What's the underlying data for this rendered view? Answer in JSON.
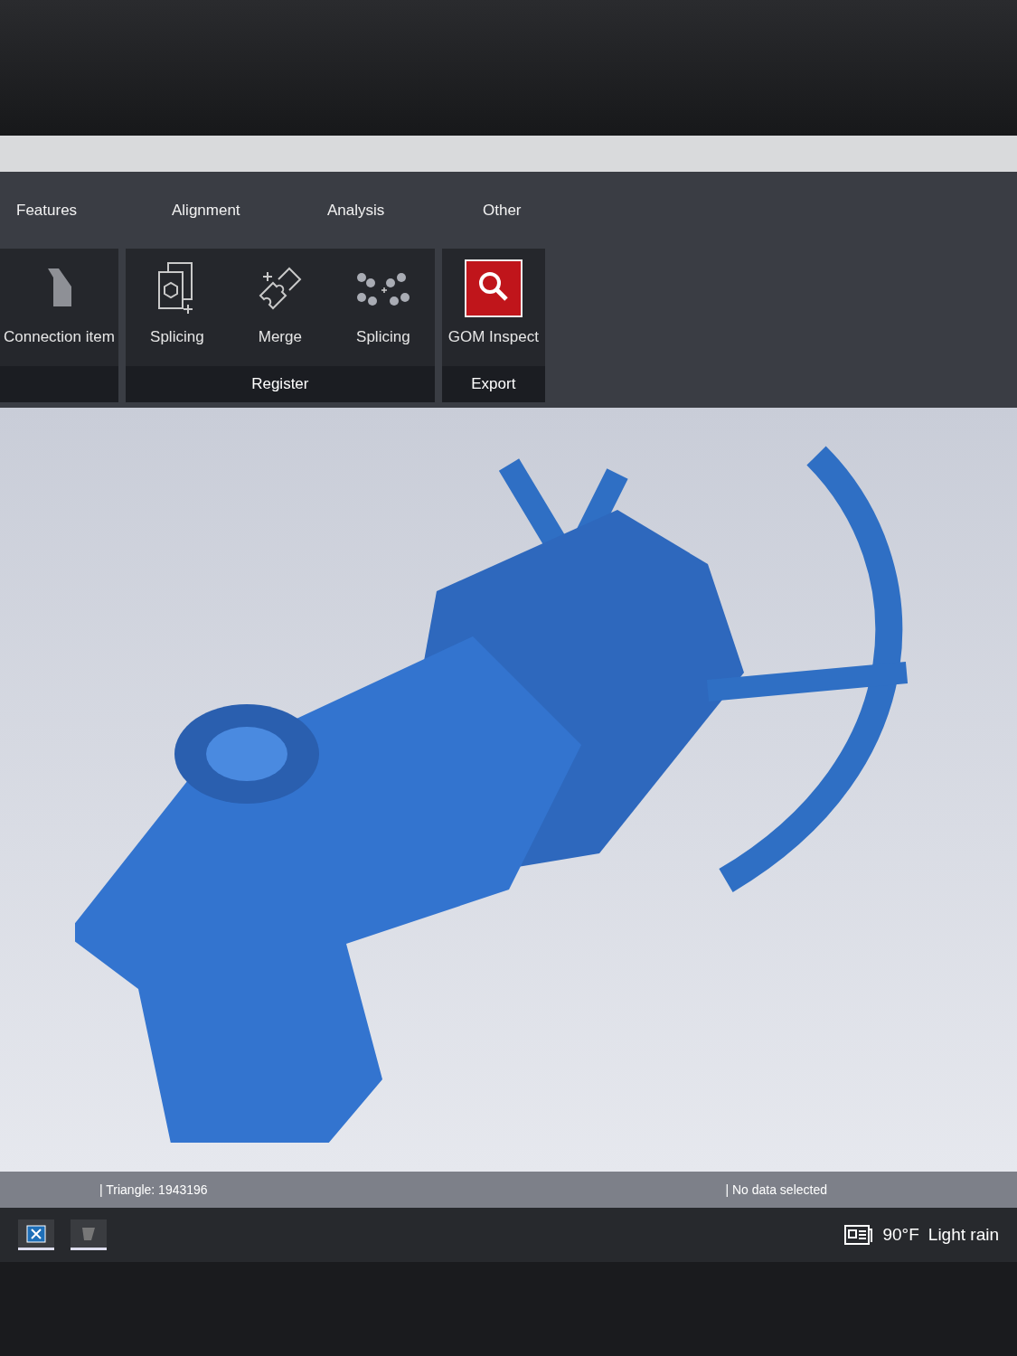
{
  "ribbon": {
    "tabs": [
      {
        "label": "Features"
      },
      {
        "label": "Alignment"
      },
      {
        "label": "Analysis"
      },
      {
        "label": "Other"
      }
    ],
    "groups": [
      {
        "tools": [
          {
            "kind": "shape",
            "label": "Connection item"
          }
        ]
      },
      {
        "title": "Register",
        "tools": [
          {
            "kind": "document",
            "label": "Splicing"
          },
          {
            "kind": "puzzle",
            "label": "Merge"
          },
          {
            "kind": "dots",
            "label": "Splicing"
          }
        ]
      },
      {
        "title": "Export",
        "tools": [
          {
            "kind": "search",
            "label": "GOM Inspect"
          }
        ]
      }
    ]
  },
  "status_bar": {
    "left": "| Triangle: 1943196",
    "right": "| No data selected"
  },
  "taskbar": {
    "weather_temp": "90°F",
    "weather_text": "Light rain"
  }
}
